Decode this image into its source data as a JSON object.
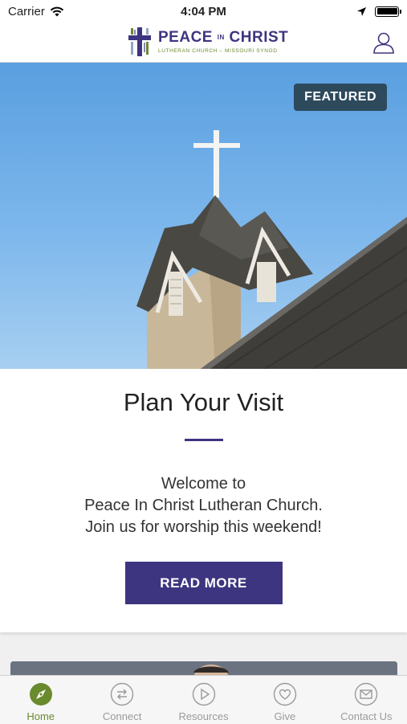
{
  "status_bar": {
    "carrier": "Carrier",
    "time": "4:04 PM"
  },
  "header": {
    "logo_title_main": "PEACE",
    "logo_title_in": "IN",
    "logo_title_end": "CHRIST",
    "logo_subtitle": "LUTHERAN CHURCH – MISSOURI SYNOD",
    "profile_icon": "person-icon"
  },
  "hero": {
    "badge": "FEATURED"
  },
  "card": {
    "title": "Plan Your Visit",
    "desc_line1": "Welcome to",
    "desc_line2": "Peace In Christ Lutheran Church.",
    "desc_line3": "Join us for worship this weekend!",
    "button": "READ MORE"
  },
  "tabs": [
    {
      "label": "Home",
      "icon": "compass-icon",
      "active": true
    },
    {
      "label": "Connect",
      "icon": "arrows-swap-icon",
      "active": false
    },
    {
      "label": "Resources",
      "icon": "play-icon",
      "active": false
    },
    {
      "label": "Give",
      "icon": "heart-icon",
      "active": false
    },
    {
      "label": "Contact Us",
      "icon": "mail-icon",
      "active": false
    }
  ],
  "colors": {
    "brand": "#3d3580",
    "accent": "#6a8a2e",
    "badge": "#2d4a5c"
  }
}
